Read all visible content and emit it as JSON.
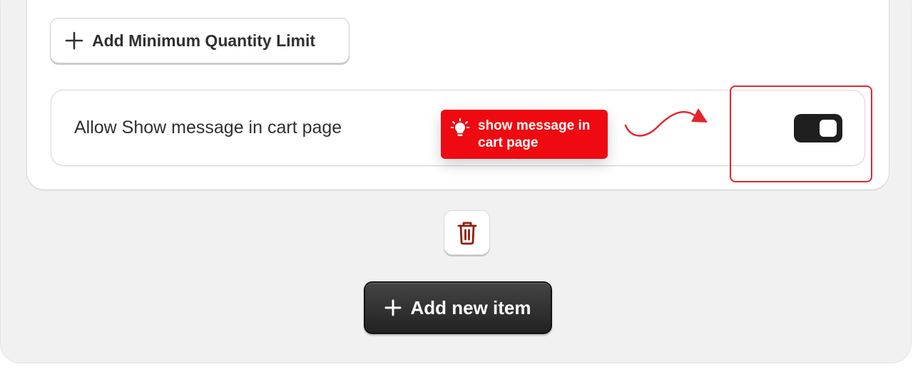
{
  "min_quantity_button": {
    "label": "Add Minimum Quantity Limit",
    "icon": "plus-icon"
  },
  "setting": {
    "label": "Allow Show message in cart page",
    "toggle_on": true
  },
  "callout": {
    "text": "show message in cart page",
    "icon": "lightbulb-icon",
    "color": "#ee0a10"
  },
  "annotation": {
    "color": "#e3262d"
  },
  "delete_button": {
    "icon": "trash-icon",
    "color": "#8e1f0b"
  },
  "add_item_button": {
    "label": "Add new item",
    "icon": "plus-icon"
  }
}
